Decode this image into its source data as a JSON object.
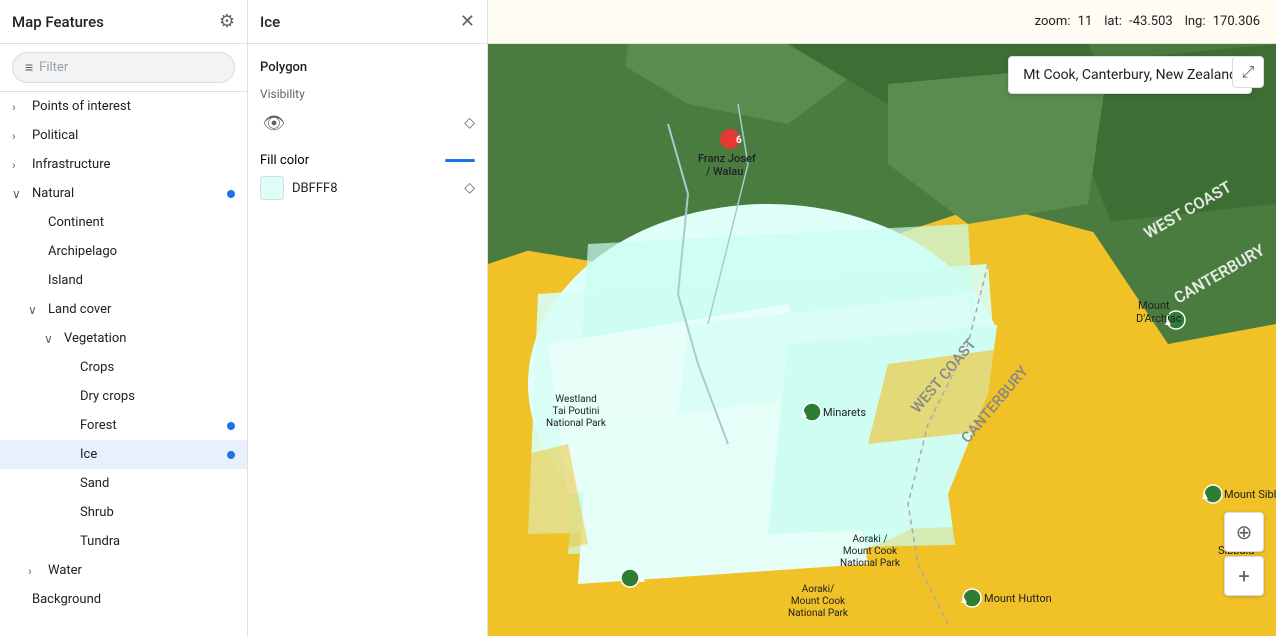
{
  "sidebar": {
    "title": "Map Features",
    "filter_placeholder": "Filter",
    "items": [
      {
        "id": "points-of-interest",
        "label": "Points of interest",
        "indent": 0,
        "has_chevron": true,
        "chevron": "›",
        "dot": false,
        "active": false
      },
      {
        "id": "political",
        "label": "Political",
        "indent": 0,
        "has_chevron": true,
        "chevron": "›",
        "dot": false,
        "active": false
      },
      {
        "id": "infrastructure",
        "label": "Infrastructure",
        "indent": 0,
        "has_chevron": true,
        "chevron": "›",
        "dot": false,
        "active": false
      },
      {
        "id": "natural",
        "label": "Natural",
        "indent": 0,
        "has_chevron": true,
        "chevron": "∨",
        "dot": true,
        "active": false
      },
      {
        "id": "continent",
        "label": "Continent",
        "indent": 1,
        "has_chevron": false,
        "dot": false,
        "active": false
      },
      {
        "id": "archipelago",
        "label": "Archipelago",
        "indent": 1,
        "has_chevron": false,
        "dot": false,
        "active": false
      },
      {
        "id": "island",
        "label": "Island",
        "indent": 1,
        "has_chevron": false,
        "dot": false,
        "active": false
      },
      {
        "id": "land-cover",
        "label": "Land cover",
        "indent": 1,
        "has_chevron": true,
        "chevron": "∨",
        "dot": false,
        "active": false
      },
      {
        "id": "vegetation",
        "label": "Vegetation",
        "indent": 2,
        "has_chevron": true,
        "chevron": "∨",
        "dot": false,
        "active": false
      },
      {
        "id": "crops",
        "label": "Crops",
        "indent": 3,
        "has_chevron": false,
        "dot": false,
        "active": false
      },
      {
        "id": "dry-crops",
        "label": "Dry crops",
        "indent": 3,
        "has_chevron": false,
        "dot": false,
        "active": false
      },
      {
        "id": "forest",
        "label": "Forest",
        "indent": 3,
        "has_chevron": false,
        "dot": true,
        "active": false
      },
      {
        "id": "ice",
        "label": "Ice",
        "indent": 3,
        "has_chevron": false,
        "dot": true,
        "active": true
      },
      {
        "id": "sand",
        "label": "Sand",
        "indent": 3,
        "has_chevron": false,
        "dot": false,
        "active": false
      },
      {
        "id": "shrub",
        "label": "Shrub",
        "indent": 3,
        "has_chevron": false,
        "dot": false,
        "active": false
      },
      {
        "id": "tundra",
        "label": "Tundra",
        "indent": 3,
        "has_chevron": false,
        "dot": false,
        "active": false
      },
      {
        "id": "water",
        "label": "Water",
        "indent": 1,
        "has_chevron": true,
        "chevron": "›",
        "dot": false,
        "active": false
      },
      {
        "id": "background",
        "label": "Background",
        "indent": 0,
        "has_chevron": false,
        "dot": false,
        "active": false
      }
    ]
  },
  "detail": {
    "title": "Ice",
    "section_label": "Polygon",
    "visibility_label": "Visibility",
    "fill_color_label": "Fill color",
    "fill_color_hex": "DBFFF8",
    "fill_color_value": "#DBFFF8"
  },
  "map": {
    "zoom_label": "zoom:",
    "zoom_value": "11",
    "lat_label": "lat:",
    "lat_value": "-43.503",
    "lng_label": "lng:",
    "lng_value": "170.306",
    "tooltip": "Mt Cook, Canterbury, New Zealand"
  }
}
